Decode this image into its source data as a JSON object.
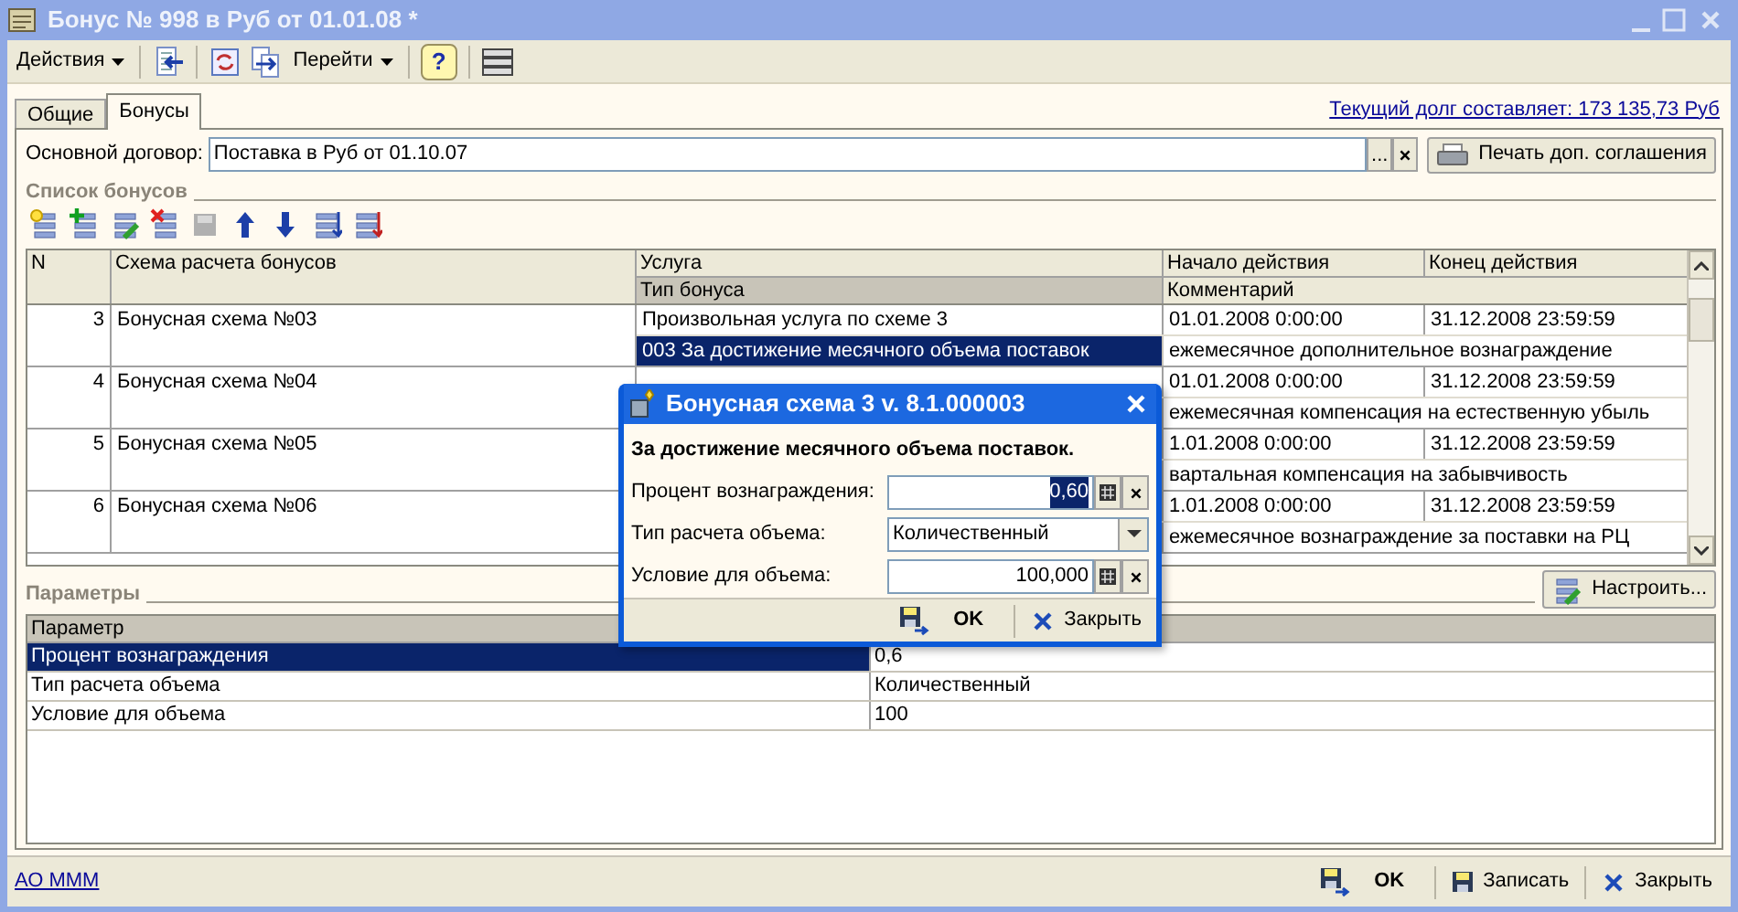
{
  "window": {
    "title": "Бонус № 998 в Руб от 01.01.08 *"
  },
  "toolbar": {
    "actions_menu": "Действия",
    "goto_menu": "Перейти",
    "help_button": "?"
  },
  "tabs": [
    {
      "label": "Общие",
      "selected": false
    },
    {
      "label": "Бонусы",
      "selected": true
    }
  ],
  "debt_link": "Текущий долг составляет: 173 135,73 Руб",
  "contract": {
    "label": "Основной договор:",
    "value": "Поставка в Руб от 01.10.07",
    "choose_button": "..."
  },
  "print_button": "Печать доп. соглашения",
  "bonus_list": {
    "title": "Список бонусов",
    "columns": {
      "n": "N",
      "scheme": "Схема расчета бонусов",
      "service": "Услуга",
      "bonus_type": "Тип бонуса",
      "start": "Начало действия",
      "end": "Конец действия",
      "comment": "Комментарий"
    },
    "rows": [
      {
        "n": "3",
        "scheme": "Бонусная схема №03",
        "service": "Произвольная услуга по схеме 3",
        "bonus_type": "003 За достижение месячного объема поставок",
        "start": "01.01.2008 0:00:00",
        "end": "31.12.2008 23:59:59",
        "comment": "ежемесячное дополнительное вознаграждение",
        "selected": true
      },
      {
        "n": "4",
        "scheme": "Бонусная схема №04",
        "start": "01.01.2008 0:00:00",
        "end": "31.12.2008 23:59:59",
        "comment": "ежемесячная компенсация на естественную убыль",
        "selected": false
      },
      {
        "n": "5",
        "scheme": "Бонусная схема №05",
        "start": "1.01.2008 0:00:00",
        "end": "31.12.2008 23:59:59",
        "comment": "вартальная компенсация на забывчивость",
        "selected": false
      },
      {
        "n": "6",
        "scheme": "Бонусная схема №06",
        "start": "1.01.2008 0:00:00",
        "end": "31.12.2008 23:59:59",
        "comment": "ежемесячное вознаграждение за поставки на РЦ",
        "selected": false
      }
    ]
  },
  "params": {
    "title": "Параметры",
    "configure_button": "Настроить...",
    "column": "Параметр",
    "rows": [
      {
        "name": "Процент вознаграждения",
        "value": "0,6",
        "selected": true
      },
      {
        "name": "Тип расчета объема",
        "value": "Количественный",
        "selected": false
      },
      {
        "name": "Условие для объема",
        "value": "100",
        "selected": false
      }
    ]
  },
  "footer": {
    "org_link": "АО МММ",
    "buttons": [
      {
        "kind": "ok",
        "label": "OK"
      },
      {
        "kind": "save",
        "label": "Записать"
      },
      {
        "kind": "close",
        "label": "Закрыть"
      }
    ]
  },
  "dialog": {
    "title": "Бонусная схема 3 v. 8.1.000003",
    "heading": "За достижение месячного объема поставок.",
    "fields": [
      {
        "kind": "number",
        "label": "Процент вознаграждения:",
        "value": "0,60",
        "selected": true
      },
      {
        "kind": "select",
        "label": "Тип расчета объема:",
        "value": "Количественный"
      },
      {
        "kind": "number",
        "label": "Условие для объема:",
        "value": "100,000",
        "selected": false
      }
    ],
    "buttons": [
      {
        "kind": "ok",
        "label": "OK"
      },
      {
        "kind": "close",
        "label": "Закрыть"
      }
    ]
  }
}
